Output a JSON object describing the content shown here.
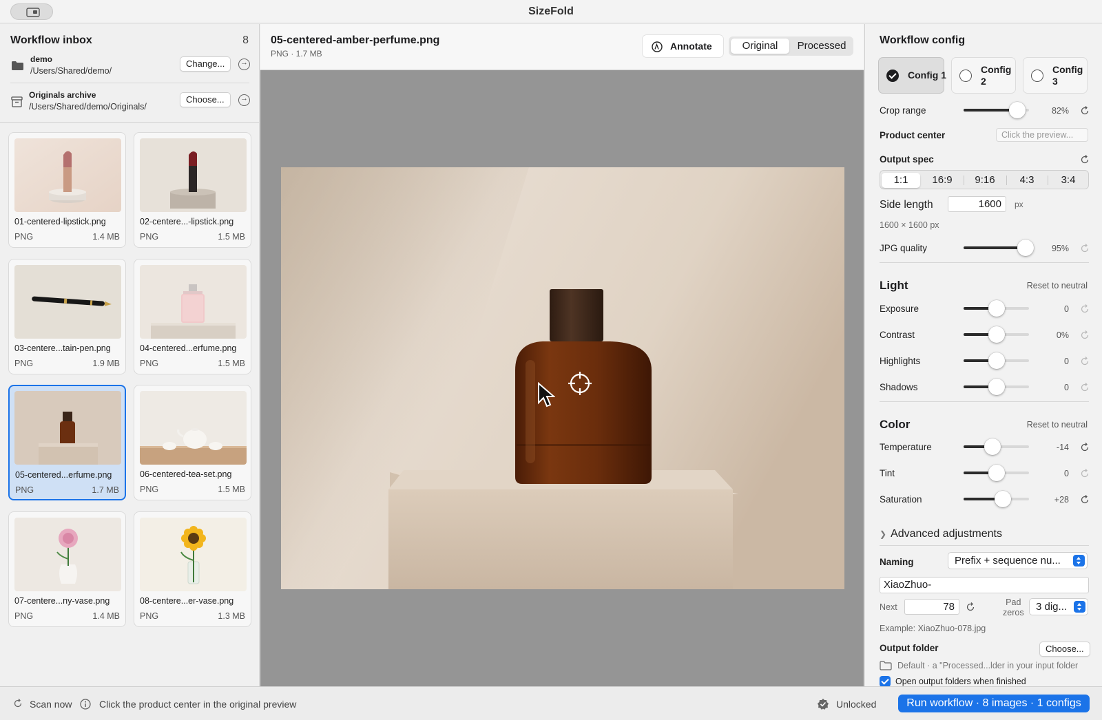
{
  "window": {
    "title": "SizeFold"
  },
  "sidebar": {
    "title": "Workflow inbox",
    "count": "8",
    "input_folder": {
      "name": "demo",
      "path": "/Users/Shared/demo/",
      "button": "Change..."
    },
    "archive_folder": {
      "name": "Originals archive",
      "path": "/Users/Shared/demo/Originals/",
      "button": "Choose..."
    },
    "files": [
      {
        "name": "01-centered-lipstick.png",
        "type": "PNG",
        "size": "1.4 MB"
      },
      {
        "name": "02-centere...-lipstick.png",
        "type": "PNG",
        "size": "1.5 MB"
      },
      {
        "name": "03-centere...tain-pen.png",
        "type": "PNG",
        "size": "1.9 MB"
      },
      {
        "name": "04-centered...erfume.png",
        "type": "PNG",
        "size": "1.5 MB"
      },
      {
        "name": "05-centered...erfume.png",
        "type": "PNG",
        "size": "1.7 MB",
        "selected": true
      },
      {
        "name": "06-centered-tea-set.png",
        "type": "PNG",
        "size": "1.5 MB"
      },
      {
        "name": "07-centere...ny-vase.png",
        "type": "PNG",
        "size": "1.4 MB"
      },
      {
        "name": "08-centere...er-vase.png",
        "type": "PNG",
        "size": "1.3 MB"
      }
    ]
  },
  "preview": {
    "file_name": "05-centered-amber-perfume.png",
    "file_meta": "PNG · 1.7 MB",
    "annotate_label": "Annotate",
    "view_modes": [
      "Original",
      "Processed"
    ],
    "active_view": "Original"
  },
  "config": {
    "title": "Workflow config",
    "configs": [
      {
        "label": "Config 1",
        "selected": true
      },
      {
        "label": "Config 2",
        "selected": false
      },
      {
        "label": "Config 3",
        "selected": false
      }
    ],
    "crop_range": {
      "label": "Crop range",
      "value": "82%",
      "level": 0.82
    },
    "product_center": {
      "label": "Product center",
      "placeholder": "Click the preview..."
    },
    "output_spec": {
      "label": "Output spec",
      "ratios": [
        "1:1",
        "16:9",
        "9:16",
        "4:3",
        "3:4"
      ],
      "selected": "1:1"
    },
    "side_length": {
      "label": "Side length",
      "value": "1600",
      "unit": "px",
      "summary": "1600 × 1600 px"
    },
    "jpg_quality": {
      "label": "JPG quality",
      "value": "95%",
      "level": 0.95
    },
    "light": {
      "title": "Light",
      "reset": "Reset to neutral",
      "exposure": {
        "label": "Exposure",
        "value": "0",
        "level": 0.5
      },
      "contrast": {
        "label": "Contrast",
        "value": "0%",
        "level": 0.5
      },
      "highlights": {
        "label": "Highlights",
        "value": "0",
        "level": 0.5
      },
      "shadows": {
        "label": "Shadows",
        "value": "0",
        "level": 0.5
      }
    },
    "color": {
      "title": "Color",
      "reset": "Reset to neutral",
      "temperature": {
        "label": "Temperature",
        "value": "-14",
        "level": 0.44
      },
      "tint": {
        "label": "Tint",
        "value": "0",
        "level": 0.5
      },
      "saturation": {
        "label": "Saturation",
        "value": "+28",
        "level": 0.6
      }
    },
    "advanced": "Advanced adjustments",
    "naming": {
      "label": "Naming",
      "mode": "Prefix + sequence nu...",
      "prefix": "XiaoZhuo-",
      "next_label": "Next",
      "next_value": "78",
      "pad_label_1": "Pad",
      "pad_label_2": "zeros",
      "pad_value": "3 dig...",
      "example": "Example: XiaoZhuo-078.jpg"
    },
    "output_folder": {
      "label": "Output folder",
      "button": "Choose...",
      "default_text": "Default · a \"Processed...lder in your input folder",
      "open_when_finished": "Open output folders when finished"
    }
  },
  "status": {
    "scan": "Scan now",
    "hint": "Click the product center in the original preview",
    "license": "Unlocked",
    "run": "Run workflow · 8 images · 1 configs"
  },
  "colors": {
    "accent": "#1b73e8",
    "amber": "#6a2f0d",
    "backdrop": "#e2d6c8"
  }
}
